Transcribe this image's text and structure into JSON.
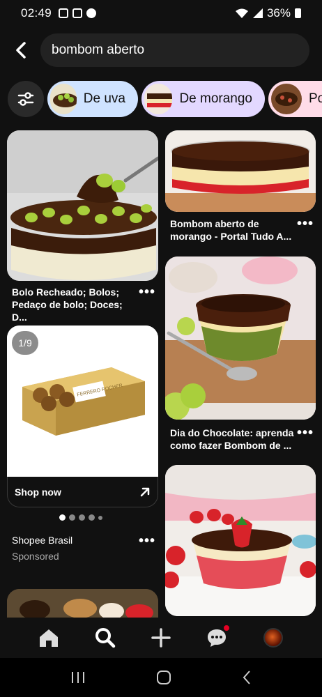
{
  "status_bar": {
    "time": "02:49",
    "battery": "36%"
  },
  "search": {
    "query": "bombom aberto"
  },
  "chips": [
    {
      "label": "De uva"
    },
    {
      "label": "De morango"
    },
    {
      "label": "Po"
    }
  ],
  "pins": [
    {
      "caption": "Bolo Recheado; Bolos; Pedaço de bolo; Doces; D..."
    },
    {
      "caption": "Bombom aberto de morango - Portal Tudo A..."
    },
    {
      "caption": "Dia do Chocolate: aprenda como fazer Bombom de ..."
    }
  ],
  "ad": {
    "counter": "1/9",
    "cta": "Shop now",
    "advertiser": "Shopee Brasil",
    "label": "Sponsored",
    "box_text": "FERRERO ROCHER"
  },
  "more_label": "•••",
  "colors": {
    "background": "#111111",
    "chip_uva": "#cfe3ff",
    "chip_morango": "#e3d8ff",
    "chip_third": "#ffdce8",
    "notification": "#e60023"
  }
}
